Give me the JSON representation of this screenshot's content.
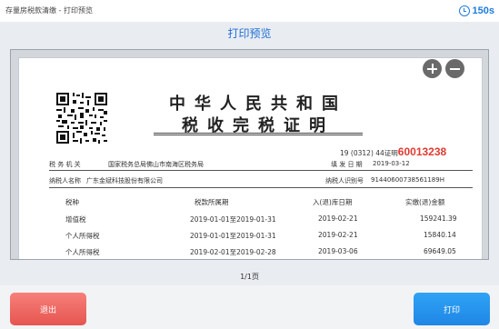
{
  "header": {
    "breadcrumb": "存量房税款清缴  -  打印预览",
    "timer": "150s",
    "page_title": "打印预览"
  },
  "preview": {
    "zoom_in_icon": "plus-circle-icon",
    "zoom_out_icon": "minus-circle-icon",
    "document": {
      "title_line1": "中华人民共和国",
      "title_line2": "税收完税证明",
      "cert_prefix": "19 (0312) 44证明",
      "cert_number": "60013238",
      "tax_office_label": "税 务 机 关",
      "tax_office": "国家税务总局佛山市南海区税务局",
      "issue_date_label": "填 发 日 期",
      "issue_date": "2019-03-12",
      "taxpayer_name_label": "纳税人名称",
      "taxpayer_name": "广东金斌科技股份有限公司",
      "taxpayer_id_label": "纳税人识别号",
      "taxpayer_id": "91440600738561189H",
      "table": {
        "headers": [
          "税种",
          "税款所属期",
          "入(退)库日期",
          "实缴(退)金额"
        ],
        "rows": [
          [
            "增值税",
            "2019-01-01至2019-01-31",
            "2019-02-21",
            "159241.39"
          ],
          [
            "个人所得税",
            "2019-01-01至2019-01-31",
            "2019-02-21",
            "15840.14"
          ],
          [
            "个人所得税",
            "2019-02-01至2019-02-28",
            "2019-03-06",
            "69649.05"
          ]
        ]
      }
    }
  },
  "pager": {
    "text": "1/1页"
  },
  "footer": {
    "exit_label": "退出",
    "print_label": "打印"
  },
  "colors": {
    "accent": "#1f6fd6",
    "exit": "#e65550",
    "print": "#1f86e6",
    "cert_number": "#e03a2e"
  }
}
